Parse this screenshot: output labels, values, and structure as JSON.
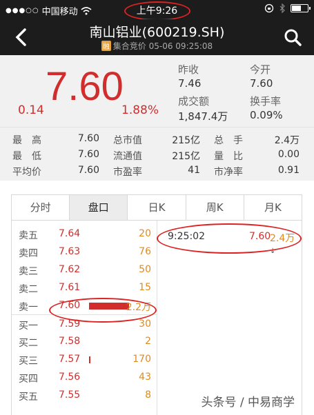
{
  "status": {
    "carrier": "中国移动",
    "time": "上午9:26"
  },
  "nav": {
    "title": "南山铝业(600219.SH)",
    "tag": "融",
    "subtitle": "集合竞价 05-06 09:25:08"
  },
  "quote": {
    "price": "7.60",
    "change": "0.14",
    "change_pct": "1.88%",
    "prev_close_label": "昨收",
    "prev_close": "7.46",
    "open_label": "今开",
    "open": "7.60",
    "amount_label": "成交额",
    "amount": "1,847.4万",
    "turnover_label": "换手率",
    "turnover": "0.09%"
  },
  "stats": [
    [
      "最　高",
      "7.60",
      "总市值",
      "215亿",
      "总　手",
      "2.4万"
    ],
    [
      "最　低",
      "7.60",
      "流通值",
      "215亿",
      "量　比",
      "0.00"
    ],
    [
      "平均价",
      "7.60",
      "市盈率",
      "41",
      "市净率",
      "0.91"
    ]
  ],
  "tabs": [
    "分时",
    "盘口",
    "日K",
    "周K",
    "月K"
  ],
  "active_tab": 1,
  "book": [
    {
      "label": "卖五",
      "price": "7.64",
      "vol": "20",
      "bar": 0
    },
    {
      "label": "卖四",
      "price": "7.63",
      "vol": "76",
      "bar": 0
    },
    {
      "label": "卖三",
      "price": "7.62",
      "vol": "50",
      "bar": 0
    },
    {
      "label": "卖二",
      "price": "7.61",
      "vol": "15",
      "bar": 0
    },
    {
      "label": "卖一",
      "price": "7.60",
      "vol": "2.2万",
      "bar": 1
    },
    {
      "label": "买一",
      "price": "7.59",
      "vol": "30",
      "bar": 0
    },
    {
      "label": "买二",
      "price": "7.58",
      "vol": "2",
      "bar": 0
    },
    {
      "label": "买三",
      "price": "7.57",
      "vol": "170",
      "bar": 0.01
    },
    {
      "label": "买四",
      "price": "7.56",
      "vol": "43",
      "bar": 0
    },
    {
      "label": "买五",
      "price": "7.55",
      "vol": "8",
      "bar": 0
    }
  ],
  "tick": {
    "time": "9:25:02",
    "price": "7.60",
    "vol": "2.4万"
  },
  "watermark": "头条号 / 中易商学",
  "colors": {
    "up": "#d22d2d",
    "vol": "#e08a1e",
    "header": "#1c1c1c"
  }
}
